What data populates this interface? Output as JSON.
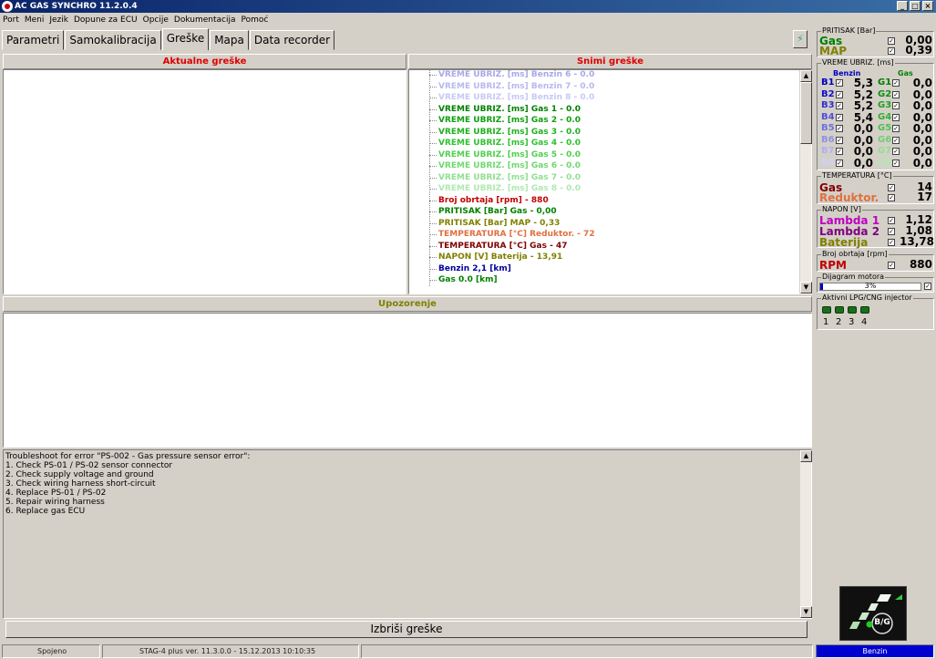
{
  "window": {
    "title": "AC GAS SYNCHRO  11.2.0.4",
    "minimize_icon": "_",
    "maximize_icon": "□",
    "close_icon": "×"
  },
  "menu": [
    "Port",
    "Meni",
    "Jezik",
    "Dopune za ECU",
    "Opcije",
    "Dokumentacija",
    "Pomoć"
  ],
  "tabs": [
    "Parametri",
    "Samokalibracija",
    "Greške",
    "Mapa",
    "Data recorder"
  ],
  "tab_ext_icon": "⚡",
  "panels": {
    "current_errors_title": "Aktualne greške",
    "saved_errors_title": "Snimi greške",
    "warnings_title": "Upozorenje"
  },
  "saved_errors": [
    {
      "text": "VREME UBRIZ. [ms] Benzin 6 - 0.0",
      "color": "#a8a8e8"
    },
    {
      "text": "VREME UBRIZ. [ms] Benzin 7 - 0.0",
      "color": "#b8b8f0"
    },
    {
      "text": "VREME UBRIZ. [ms] Benzin 8 - 0.0",
      "color": "#c8c8f8"
    },
    {
      "text": "VREME UBRIZ. [ms] Gas 1 - 0.0",
      "color": "#008000"
    },
    {
      "text": "VREME UBRIZ. [ms] Gas 2 - 0.0",
      "color": "#10a010"
    },
    {
      "text": "VREME UBRIZ. [ms] Gas 3 - 0.0",
      "color": "#20b020"
    },
    {
      "text": "VREME UBRIZ. [ms] Gas 4 - 0.0",
      "color": "#30c030"
    },
    {
      "text": "VREME UBRIZ. [ms] Gas 5 - 0.0",
      "color": "#50d050"
    },
    {
      "text": "VREME UBRIZ. [ms] Gas 6 - 0.0",
      "color": "#70d870"
    },
    {
      "text": "VREME UBRIZ. [ms] Gas 7 - 0.0",
      "color": "#90e090"
    },
    {
      "text": "VREME UBRIZ. [ms] Gas 8 - 0.0",
      "color": "#b0e8b0"
    },
    {
      "text": "Broj obrtaja [rpm] - 880",
      "color": "#c00000"
    },
    {
      "text": "PRITISAK [Bar] Gas - 0,00",
      "color": "#008000"
    },
    {
      "text": "PRITISAK [Bar] MAP - 0,33",
      "color": "#808000"
    },
    {
      "text": "TEMPERATURA [°C] Reduktor. - 72",
      "color": "#e07040"
    },
    {
      "text": "TEMPERATURA [°C] Gas - 47",
      "color": "#800000"
    },
    {
      "text": "NAPON [V] Baterija - 13,91",
      "color": "#808000"
    },
    {
      "text": "Benzin 2,1 [km]",
      "color": "#0000a0"
    },
    {
      "text": "Gas 0.0 [km]",
      "color": "#008000"
    }
  ],
  "troubleshoot": [
    "Troubleshoot for error \"PS-002 - Gas pressure sensor error\":",
    "1. Check PS-01 / PS-02 sensor connector",
    "2. Check supply voltage and ground",
    "3. Check wiring harness short-circuit",
    "4. Replace PS-01 / PS-02",
    "5. Repair wiring harness",
    "6. Replace gas ECU"
  ],
  "clear_errors_label": "Izbriši greške",
  "right": {
    "pressure": {
      "title": "PRITISAK [Bar]",
      "rows": [
        {
          "label": "Gas",
          "value": "0,00",
          "color": "#008000"
        },
        {
          "label": "MAP",
          "value": "0,39",
          "color": "#808000"
        }
      ]
    },
    "injection": {
      "title": "VREME UBRIZ. [ms]",
      "col_benzin": "Benzin",
      "col_gas": "Gas",
      "rows": [
        {
          "b": "B1",
          "bv": "5,3",
          "g": "G1",
          "gv": "0,0",
          "bc": "#0000c0",
          "gc": "#008000"
        },
        {
          "b": "B2",
          "bv": "5,2",
          "g": "G2",
          "gv": "0,0",
          "bc": "#1010c8",
          "gc": "#109010"
        },
        {
          "b": "B3",
          "bv": "5,2",
          "g": "G3",
          "gv": "0,0",
          "bc": "#3030d0",
          "gc": "#20a020"
        },
        {
          "b": "B4",
          "bv": "5,4",
          "g": "G4",
          "gv": "0,0",
          "bc": "#5050d8",
          "gc": "#30b030"
        },
        {
          "b": "B5",
          "bv": "0,0",
          "g": "G5",
          "gv": "0,0",
          "bc": "#7070e0",
          "gc": "#50c050"
        },
        {
          "b": "B6",
          "bv": "0,0",
          "g": "G6",
          "gv": "0,0",
          "bc": "#9090e8",
          "gc": "#70d070"
        },
        {
          "b": "B7",
          "bv": "0,0",
          "g": "G7",
          "gv": "0,0",
          "bc": "#b0b0f0",
          "gc": "#90e090"
        },
        {
          "b": "B8",
          "bv": "0,0",
          "g": "G8",
          "gv": "0,0",
          "bc": "#d0d0f8",
          "gc": "#b0e8b0"
        }
      ]
    },
    "temperature": {
      "title": "TEMPERATURA [°C]",
      "rows": [
        {
          "label": "Gas",
          "value": "14",
          "color": "#800000"
        },
        {
          "label": "Reduktor.",
          "value": "17",
          "color": "#e07040"
        }
      ]
    },
    "voltage": {
      "title": "NAPON [V]",
      "rows": [
        {
          "label": "Lambda 1",
          "value": "1,12",
          "color": "#c000c0"
        },
        {
          "label": "Lambda 2",
          "value": "1,08",
          "color": "#800080"
        },
        {
          "label": "Baterija",
          "value": "13,78",
          "color": "#808000"
        }
      ]
    },
    "rpm": {
      "title": "Broj obrtaja [rpm]",
      "label": "RPM",
      "value": "880",
      "color": "#c00000"
    },
    "engine_load": {
      "title": "Dijagram motora",
      "value": "3%",
      "fraction": 0.03
    },
    "injectors": {
      "title": "Aktivni LPG/CNG injector",
      "numbers": [
        "1",
        "2",
        "3",
        "4"
      ]
    },
    "logo_text": "B/G",
    "checkmark": "✓"
  },
  "status": {
    "connection": "Spojeno",
    "version": "STAG-4 plus   ver. 11.3.0.0  - 15.12.2013 10:10:35",
    "fuel": "Benzin",
    "fuel_bg": "#0000d0"
  }
}
